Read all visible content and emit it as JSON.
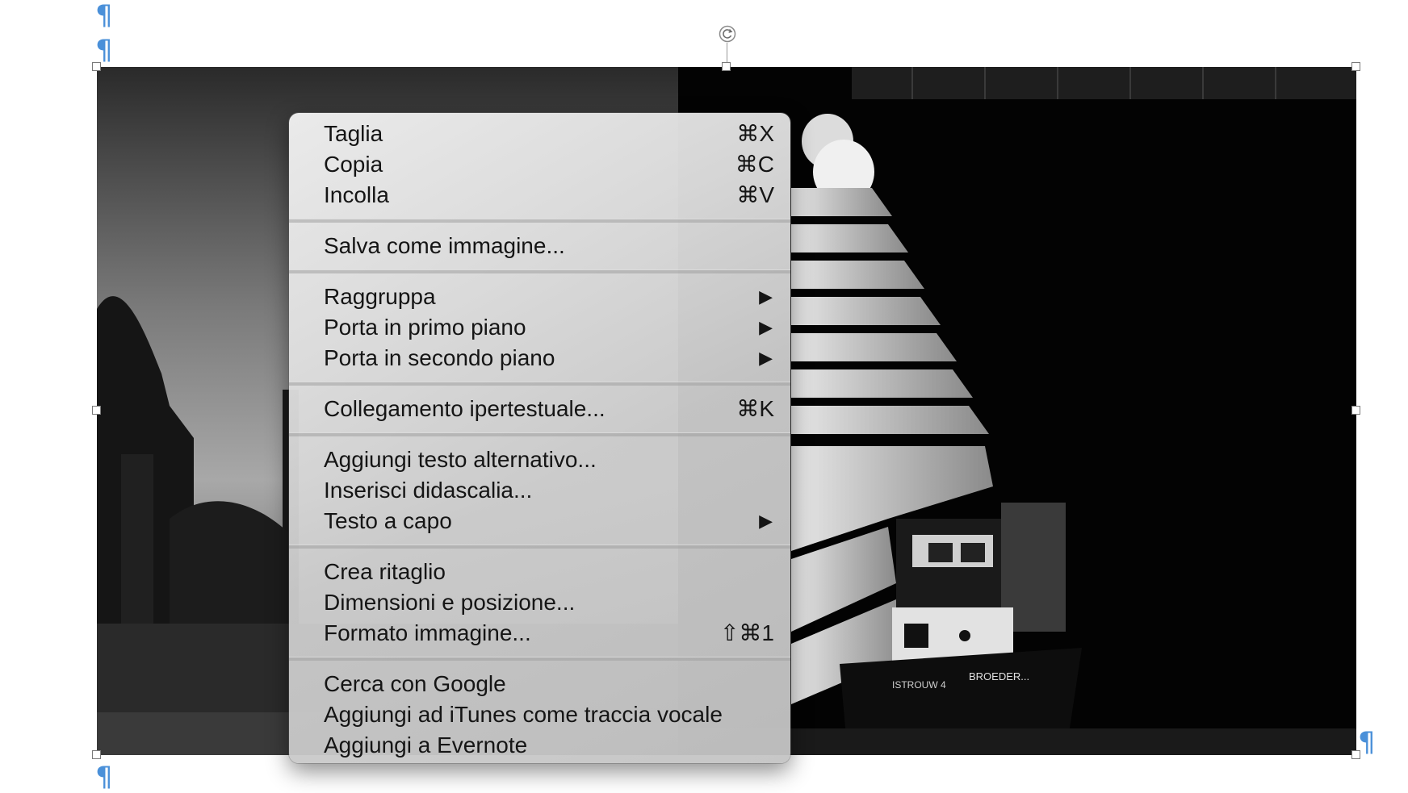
{
  "document": {
    "pilcrow_glyph": "¶",
    "rotate_glyph": "↻"
  },
  "context_menu": {
    "groups": [
      {
        "items": [
          {
            "label": "Taglia",
            "shortcut": "⌘X"
          },
          {
            "label": "Copia",
            "shortcut": "⌘C"
          },
          {
            "label": "Incolla",
            "shortcut": "⌘V"
          }
        ]
      },
      {
        "items": [
          {
            "label": "Salva come immagine..."
          }
        ]
      },
      {
        "items": [
          {
            "label": "Raggruppa",
            "submenu": "▶"
          },
          {
            "label": "Porta in primo piano",
            "submenu": "▶"
          },
          {
            "label": "Porta in secondo piano",
            "submenu": "▶"
          }
        ]
      },
      {
        "items": [
          {
            "label": "Collegamento ipertestuale...",
            "shortcut": "⌘K"
          }
        ]
      },
      {
        "items": [
          {
            "label": "Aggiungi testo alternativo..."
          },
          {
            "label": "Inserisci didascalia..."
          },
          {
            "label": "Testo a capo",
            "submenu": "▶"
          }
        ]
      },
      {
        "items": [
          {
            "label": "Crea ritaglio"
          },
          {
            "label": "Dimensioni e posizione..."
          },
          {
            "label": "Formato immagine...",
            "shortcut": "⇧⌘1"
          }
        ]
      },
      {
        "items": [
          {
            "label": "Cerca con Google"
          },
          {
            "label": "Aggiungi ad iTunes come traccia vocale"
          },
          {
            "label": "Aggiungi a Evernote"
          }
        ]
      }
    ]
  },
  "colors": {
    "pilcrow": "#4a90d9",
    "menu_text": "#151515"
  },
  "image": {
    "boat_label_left": "ISTROUW 4",
    "boat_label_right": "BROEDER..."
  }
}
